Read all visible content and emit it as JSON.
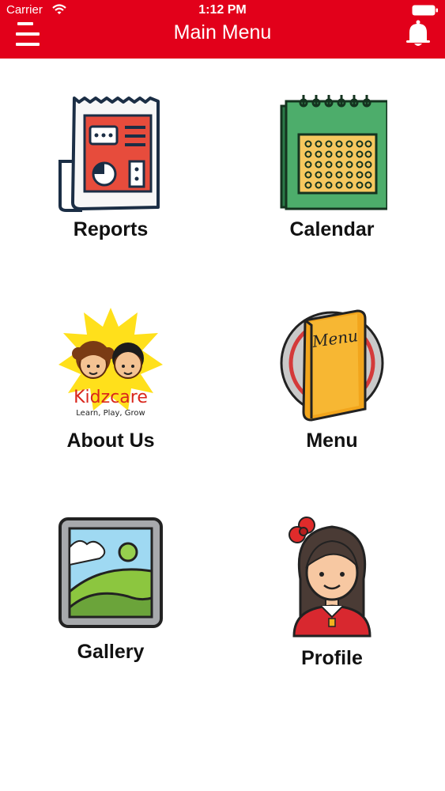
{
  "status_bar": {
    "carrier": "Carrier",
    "time": "1:12 PM"
  },
  "header": {
    "title": "Main Menu",
    "menu_icon": "hamburger-icon",
    "notification_icon": "bell-icon",
    "background_color": "#e2001a"
  },
  "tiles": [
    {
      "label": "Reports",
      "icon": "reports-icon"
    },
    {
      "label": "Calendar",
      "icon": "calendar-icon"
    },
    {
      "label": "About Us",
      "icon": "kidzcare-logo",
      "logo_text": "Kidzcare",
      "logo_tagline": "Learn, Play, Grow"
    },
    {
      "label": "Menu",
      "icon": "food-menu-icon",
      "icon_text": "Menu"
    },
    {
      "label": "Gallery",
      "icon": "gallery-icon"
    },
    {
      "label": "Profile",
      "icon": "profile-icon"
    }
  ]
}
